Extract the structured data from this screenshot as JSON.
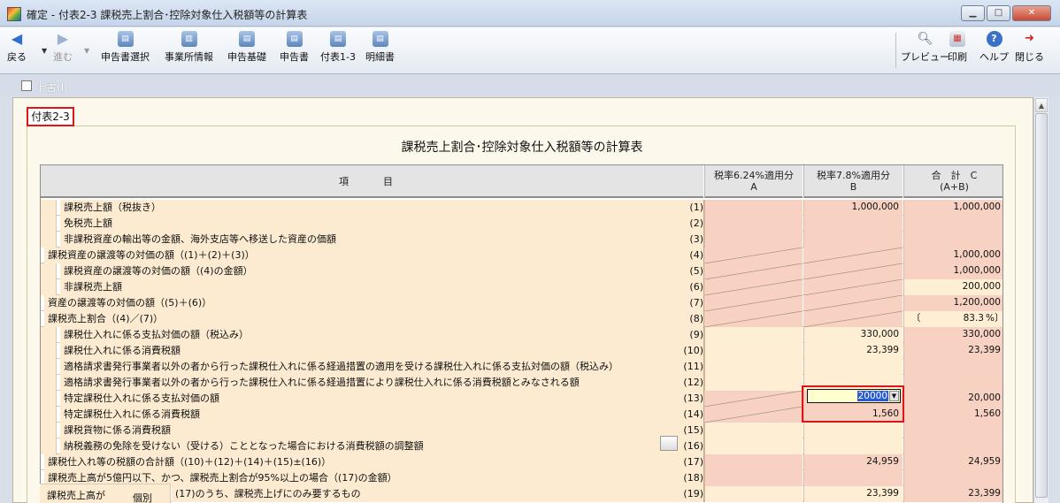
{
  "window": {
    "title": "確定 - 付表2-3 課税売上割合･控除対象仕入税額等の計算表"
  },
  "toolbar": {
    "back": "戻る",
    "forward": "進む",
    "items": [
      "申告書選択",
      "事業所情報",
      "申告基礎",
      "申告書",
      "付表1-3",
      "明細書"
    ],
    "preview": "プレビュー",
    "print": "印刷",
    "help": "ヘルプ",
    "close": "閉じる"
  },
  "option": {
    "overwrite_label": "上書(I)"
  },
  "tab": {
    "label": "付表2-3"
  },
  "sheet": {
    "title": "課税売上割合･控除対象仕入税額等の計算表",
    "headers": {
      "item": "項　目",
      "col_a": [
        "税率6.24%適用分",
        "A"
      ],
      "col_b": [
        "税率7.8%適用分",
        "B"
      ],
      "col_c": [
        "合　計　C",
        "(A+B)"
      ]
    },
    "rows": [
      {
        "label": "課税売上額（税抜き）",
        "no": "(1)",
        "a": "",
        "b": "1,000,000",
        "c": "1,000,000"
      },
      {
        "label": "免税売上額",
        "no": "(2)",
        "a": "",
        "b": "",
        "c": ""
      },
      {
        "label": "非課税資産の輸出等の金額、海外支店等へ移送した資産の価額",
        "no": "(3)",
        "a": "",
        "b": "",
        "c": ""
      },
      {
        "label": "課税資産の譲渡等の対価の額（(1)＋(2)＋(3)）",
        "no": "(4)",
        "a": "",
        "b": "",
        "c": "1,000,000"
      },
      {
        "label": "課税資産の譲渡等の対価の額（(4)の金額）",
        "no": "(5)",
        "a": "",
        "b": "",
        "c": "1,000,000"
      },
      {
        "label": "非課税売上額",
        "no": "(6)",
        "a": "",
        "b": "",
        "c": "200,000"
      },
      {
        "label": "資産の譲渡等の対価の額（(5)＋(6)）",
        "no": "(7)",
        "a": "",
        "b": "",
        "c": "1,200,000"
      },
      {
        "label": "課税売上割合（(4)／(7)）",
        "no": "(8)",
        "a": "",
        "b": "",
        "c": ""
      },
      {
        "label": "課税仕入れに係る支払対価の額（税込み）",
        "no": "(9)",
        "a": "",
        "b": "330,000",
        "c": "330,000"
      },
      {
        "label": "課税仕入れに係る消費税額",
        "no": "(10)",
        "a": "",
        "b": "23,399",
        "c": "23,399"
      },
      {
        "label": "適格請求書発行事業者以外の者から行った課税仕入れに係る経過措置の適用を受ける課税仕入れに係る支払対価の額（税込み）",
        "no": "(11)",
        "a": "",
        "b": "",
        "c": ""
      },
      {
        "label": "適格請求書発行事業者以外の者から行った課税仕入れに係る経過措置により課税仕入れに係る消費税額とみなされる額",
        "no": "(12)",
        "a": "",
        "b": "",
        "c": ""
      },
      {
        "label": "特定課税仕入れに係る支払対価の額",
        "no": "(13)",
        "a": "",
        "b": "",
        "c": "20,000"
      },
      {
        "label": "特定課税仕入れに係る消費税額",
        "no": "(14)",
        "a": "",
        "b": "1,560",
        "c": "1,560"
      },
      {
        "label": "課税貨物に係る消費税額",
        "no": "(15)",
        "a": "",
        "b": "",
        "c": ""
      },
      {
        "label": "納税義務の免除を受けない（受ける）こととなった場合における消費税額の調整額",
        "no": "(16)",
        "a": "",
        "b": "",
        "c": ""
      },
      {
        "label": "課税仕入れ等の税額の合計額（(10)＋(12)＋(14)＋(15)±(16)）",
        "no": "(17)",
        "a": "",
        "b": "24,959",
        "c": "24,959"
      },
      {
        "label": "課税売上高が5億円以下、かつ、課税売上割合が95%以上の場合（(17)の金額）",
        "no": "(18)",
        "a": "",
        "b": "",
        "c": ""
      },
      {
        "label": "(17)のうち、課税売上げにのみ要するもの",
        "no": "(19)",
        "a": "",
        "b": "23,399",
        "c": "23,399"
      }
    ],
    "ratio": {
      "open": "〔",
      "value": "83.3",
      "close": "%〕"
    },
    "entry": {
      "value": "20000"
    },
    "side": {
      "label1": "課税売上高が",
      "label2": "個別"
    }
  }
}
